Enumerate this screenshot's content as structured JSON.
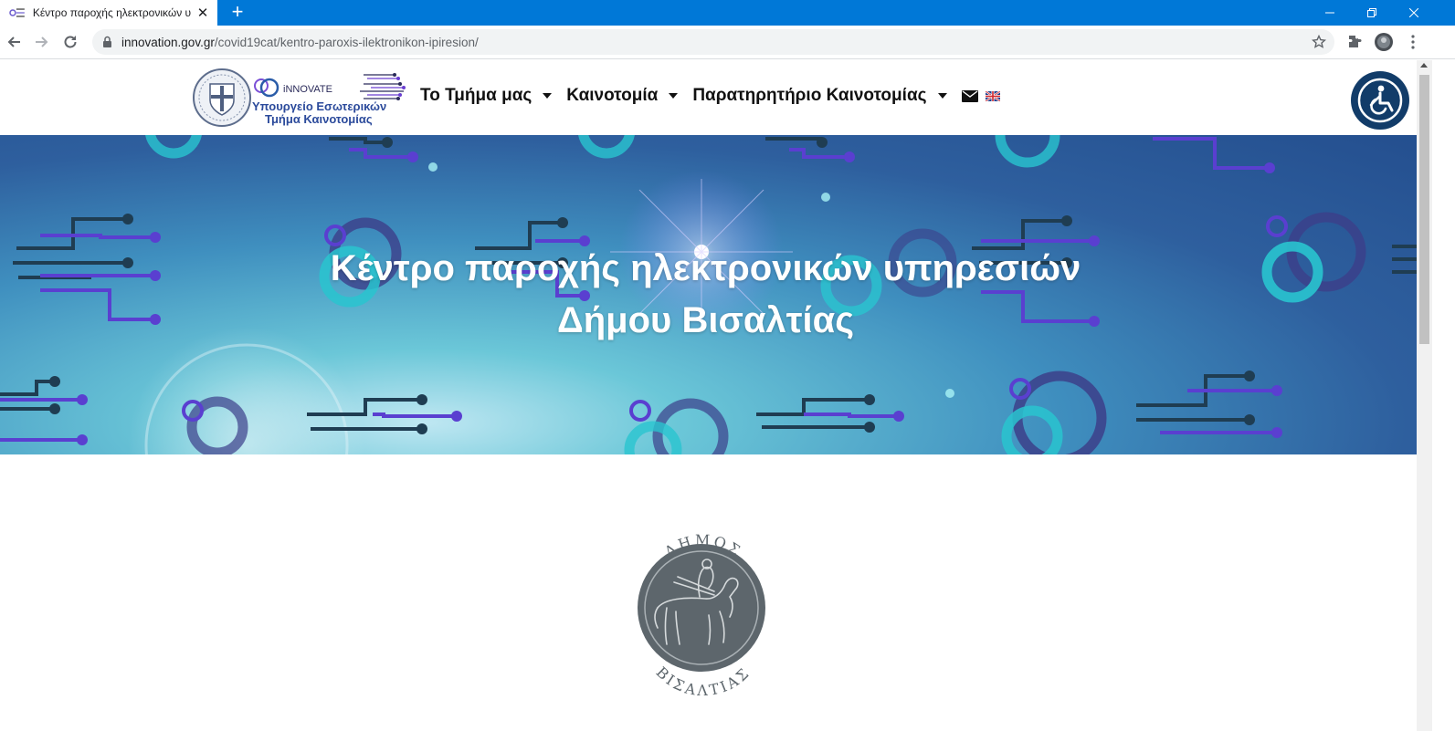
{
  "browser": {
    "tab_title": "Κέντρο παροχής ηλεκτρονικών υ",
    "url_host": "innovation.gov.gr",
    "url_path": "/covid19cat/kentro-paroxis-ilektronikon-ipiresion/"
  },
  "header": {
    "logo": {
      "brand": "iNNOVATE",
      "line1": "Υπουργείο Εσωτερικών",
      "line2": "Τμήμα Καινοτομίας"
    },
    "nav": [
      {
        "label": "Το Τμήμα μας"
      },
      {
        "label": "Καινοτομία"
      },
      {
        "label": "Παρατηρητήριο Καινοτομίας"
      }
    ]
  },
  "hero": {
    "title_line1": "Κέντρο παροχής ηλεκτρονικών υπηρεσιών",
    "title_line2": "Δήμου Βισαλτίας"
  },
  "emblem": {
    "top_text": "ΔΗΜΟΣ",
    "bottom_text": "ΒΙΣΑΛΤΙΑΣ"
  },
  "colors": {
    "titlebar": "#0078d7",
    "accessibility": "#123c69",
    "logo_blue": "#2b4a9b",
    "circuit_purple": "#5a3fd0",
    "emblem_gray": "#5d666c"
  },
  "icons": [
    "favicon-icon",
    "close-icon",
    "plus-icon",
    "minimize-icon",
    "restore-icon",
    "window-close-icon",
    "back-arrow-icon",
    "forward-arrow-icon",
    "reload-icon",
    "lock-icon",
    "star-icon",
    "extensions-icon",
    "profile-avatar-icon",
    "more-menu-icon",
    "mail-icon",
    "uk-flag-icon",
    "accessibility-icon"
  ]
}
